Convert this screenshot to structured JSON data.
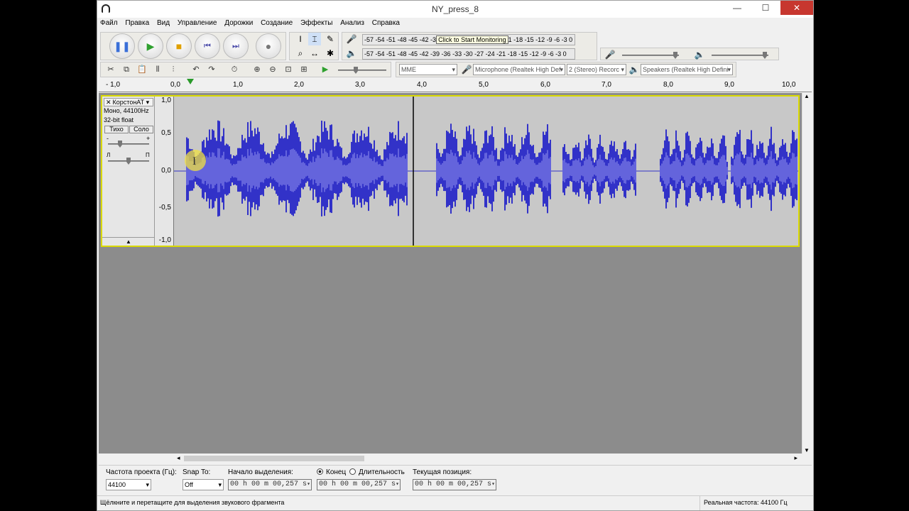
{
  "window": {
    "title": "NY_press_8",
    "min": "—",
    "max": "☐",
    "close": "✕"
  },
  "menu": [
    "Файл",
    "Правка",
    "Вид",
    "Управление",
    "Дорожки",
    "Создание",
    "Эффекты",
    "Анализ",
    "Справка"
  ],
  "meters": {
    "rec_scale": "-57 -54 -51 -48 -45 -42 -3",
    "rec_tooltip": "Click to Start Monitoring",
    "rec_scale_tail": "1 -18 -15 -12  -9  -6  -3  0",
    "play_scale": "-57 -54 -51 -48 -45 -42 -39 -36 -33 -30 -27 -24 -21 -18 -15 -12  -9  -6  -3  0",
    "lr_top": "Л\nП"
  },
  "devices": {
    "host": "MME",
    "mic": "Microphone (Realtek High Def",
    "channels": "2 (Stereo) Recorc",
    "speakers": "Speakers (Realtek High Defini"
  },
  "ruler": [
    "- 1,0",
    "0,0",
    "1,0",
    "2,0",
    "3,0",
    "4,0",
    "5,0",
    "6,0",
    "7,0",
    "8,0",
    "9,0",
    "10,0"
  ],
  "track": {
    "name": "КорстонАТ",
    "close": "✕",
    "format": "Моно, 44100Hz",
    "bits": "32-bit float",
    "mute": "Тихо",
    "solo": "Соло",
    "gain_minus": "-",
    "gain_plus": "+",
    "pan_l": "Л",
    "pan_r": "П",
    "scale": [
      "1,0",
      "0,5",
      "0,0",
      "-0,5",
      "-1,0"
    ],
    "collapse": "▲"
  },
  "selection_bar": {
    "rate_label": "Частота проекта (Гц):",
    "rate_value": "44100",
    "snap_label": "Snap To:",
    "snap_value": "Off",
    "start_label": "Начало выделения:",
    "end_radio": "Конец",
    "len_radio": "Длительность",
    "pos_label": "Текущая позиция:",
    "start_time": "00 h 00 m 00,257 s",
    "end_time": "00 h 00 m 00,257 s",
    "pos_time": "00 h 00 m 00,257 s"
  },
  "status": {
    "hint": "Щёлкните и перетащите для выделения звукового фрагмента",
    "rate": "Реальная частота: 44100 Гц"
  },
  "colors": {
    "wave": "#3232c8",
    "wave_rms": "#6464dc",
    "track_bg": "#c8c8c8",
    "selected_border": "#dada00"
  }
}
